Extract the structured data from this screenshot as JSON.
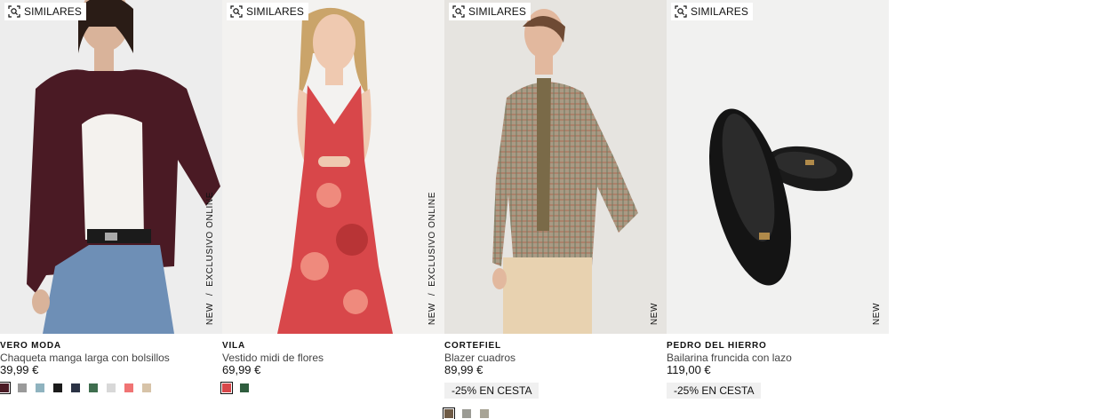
{
  "similar_label": "SIMILARES",
  "products": [
    {
      "brand": "VERO MODA",
      "name": "Chaqueta manga larga con bolsillos",
      "price": "39,99 €",
      "tag_new": "NEW",
      "tag_sep": "/",
      "tag_online": "EXCLUSIVO ONLINE",
      "promo": "",
      "swatches": [
        "#4a1a24",
        "#9a9a9a",
        "#8fb3bf",
        "#1b1b1b",
        "#2a3244",
        "#3f6e4f",
        "#d8d8d8",
        "#f07474",
        "#d7c3a8"
      ]
    },
    {
      "brand": "VILA",
      "name": "Vestido midi de flores",
      "price": "69,99 €",
      "tag_new": "NEW",
      "tag_sep": "/",
      "tag_online": "EXCLUSIVO ONLINE",
      "promo": "",
      "swatches": [
        "#d8474a",
        "#2f5d3e"
      ]
    },
    {
      "brand": "CORTEFIEL",
      "name": "Blazer cuadros",
      "price": "89,99 €",
      "tag_new": "NEW",
      "promo": "-25% EN CESTA",
      "swatches": [
        "#6e5a45",
        "#9b9b94",
        "#a8a496"
      ]
    },
    {
      "brand": "PEDRO DEL HIERRO",
      "name": "Bailarina fruncida con lazo",
      "price": "119,00 €",
      "tag_new": "NEW",
      "promo": "-25% EN CESTA",
      "swatches": []
    }
  ]
}
